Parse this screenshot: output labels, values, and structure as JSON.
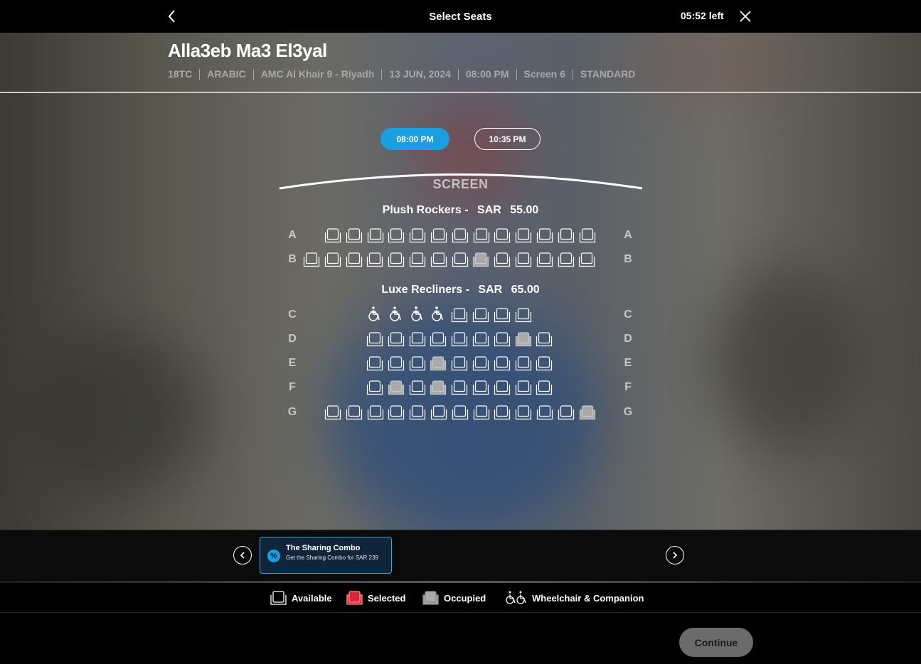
{
  "header": {
    "title": "Select Seats",
    "timer": "05:52 left"
  },
  "movie": {
    "title": "Alla3eb Ma3 El3yal",
    "meta": [
      "18TC",
      "ARABIC",
      "AMC Al Khair 9 - Riyadh",
      "13 JUN, 2024",
      "08:00 PM",
      "Screen 6",
      "STANDARD"
    ]
  },
  "showtimes": {
    "selected": "08:00 PM",
    "other": "10:35 PM"
  },
  "screen_label": "SCREEN",
  "sections": [
    {
      "name": "Plush Rockers -",
      "currency": "SAR",
      "price": "55.00"
    },
    {
      "name": "Luxe Recliners -",
      "currency": "SAR",
      "price": "65.00"
    }
  ],
  "rows": [
    {
      "label": "A",
      "seats": [
        "a",
        "a",
        "a",
        "a",
        "a",
        "a",
        "a",
        "a",
        "a",
        "a",
        "a",
        "a",
        "a"
      ]
    },
    {
      "label": "B",
      "seats": [
        "a",
        "a",
        "a",
        "a",
        "a",
        "a",
        "a",
        "a",
        "o",
        "a",
        "a",
        "a",
        "a",
        "a"
      ]
    },
    {
      "label": "C",
      "seats": [
        "w",
        "w",
        "w",
        "w",
        "a",
        "a",
        "a",
        "a"
      ]
    },
    {
      "label": "D",
      "seats": [
        "a",
        "a",
        "a",
        "a",
        "a",
        "a",
        "a",
        "o",
        "a"
      ]
    },
    {
      "label": "E",
      "seats": [
        "a",
        "a",
        "a",
        "o",
        "a",
        "a",
        "a",
        "a",
        "a"
      ]
    },
    {
      "label": "F",
      "seats": [
        "a",
        "o",
        "a",
        "o",
        "a",
        "a",
        "a",
        "a",
        "a"
      ]
    },
    {
      "label": "G",
      "seats": [
        "a",
        "a",
        "a",
        "a",
        "a",
        "a",
        "a",
        "a",
        "a",
        "a",
        "a",
        "a",
        "o"
      ]
    }
  ],
  "promo": {
    "title": "The Sharing Combo",
    "description": "Get the Sharing Combo for SAR 239",
    "icon": "%"
  },
  "legend": {
    "available": "Available",
    "selected": "Selected",
    "occupied": "Occupied",
    "wheelchair": "Wheelchair & Companion"
  },
  "colors": {
    "accent": "#1a9fe0",
    "selected": "#d9263a",
    "occupied": "#a9a9a9"
  },
  "continue_label": "Continue"
}
